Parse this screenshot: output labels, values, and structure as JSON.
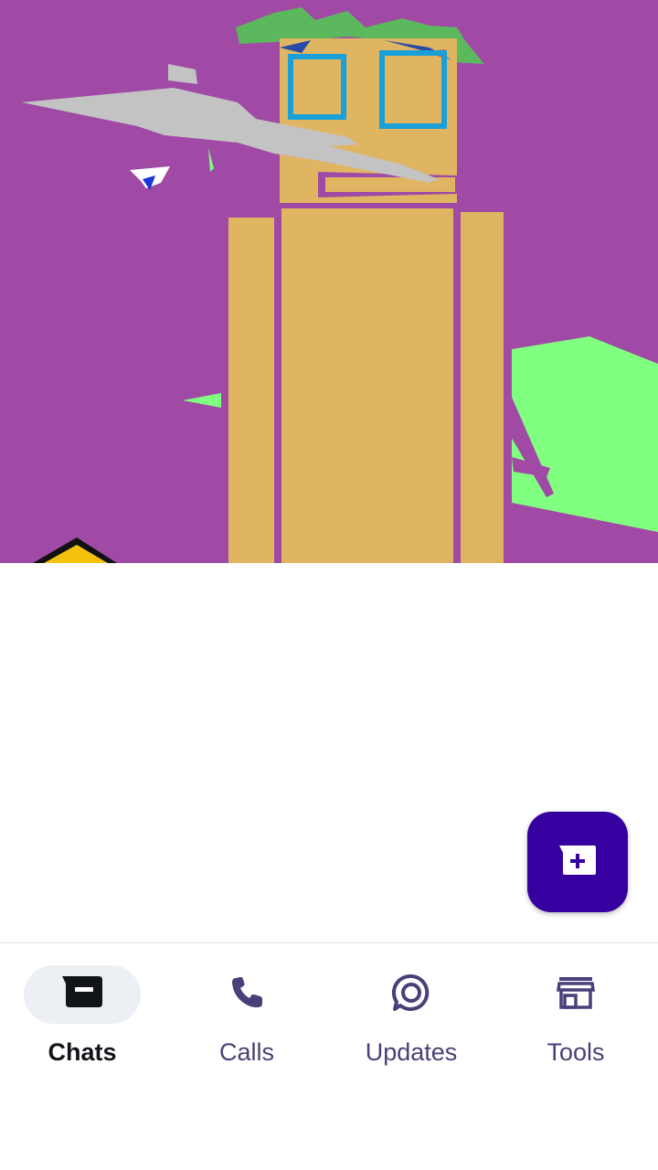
{
  "colors": {
    "hero_background": "#a04aa6",
    "fab_background": "#35009f",
    "nav_active_pill": "#eceff4",
    "nav_label_inactive": "#4a3f78",
    "nav_label_active": "#111418"
  },
  "fab": {
    "icon": "new-chat-icon"
  },
  "bottom_nav": {
    "items": [
      {
        "label": "Chats",
        "icon": "chats-icon",
        "active": true
      },
      {
        "label": "Calls",
        "icon": "phone-icon",
        "active": false
      },
      {
        "label": "Updates",
        "icon": "updates-icon",
        "active": false
      },
      {
        "label": "Tools",
        "icon": "store-icon",
        "active": false
      }
    ]
  }
}
